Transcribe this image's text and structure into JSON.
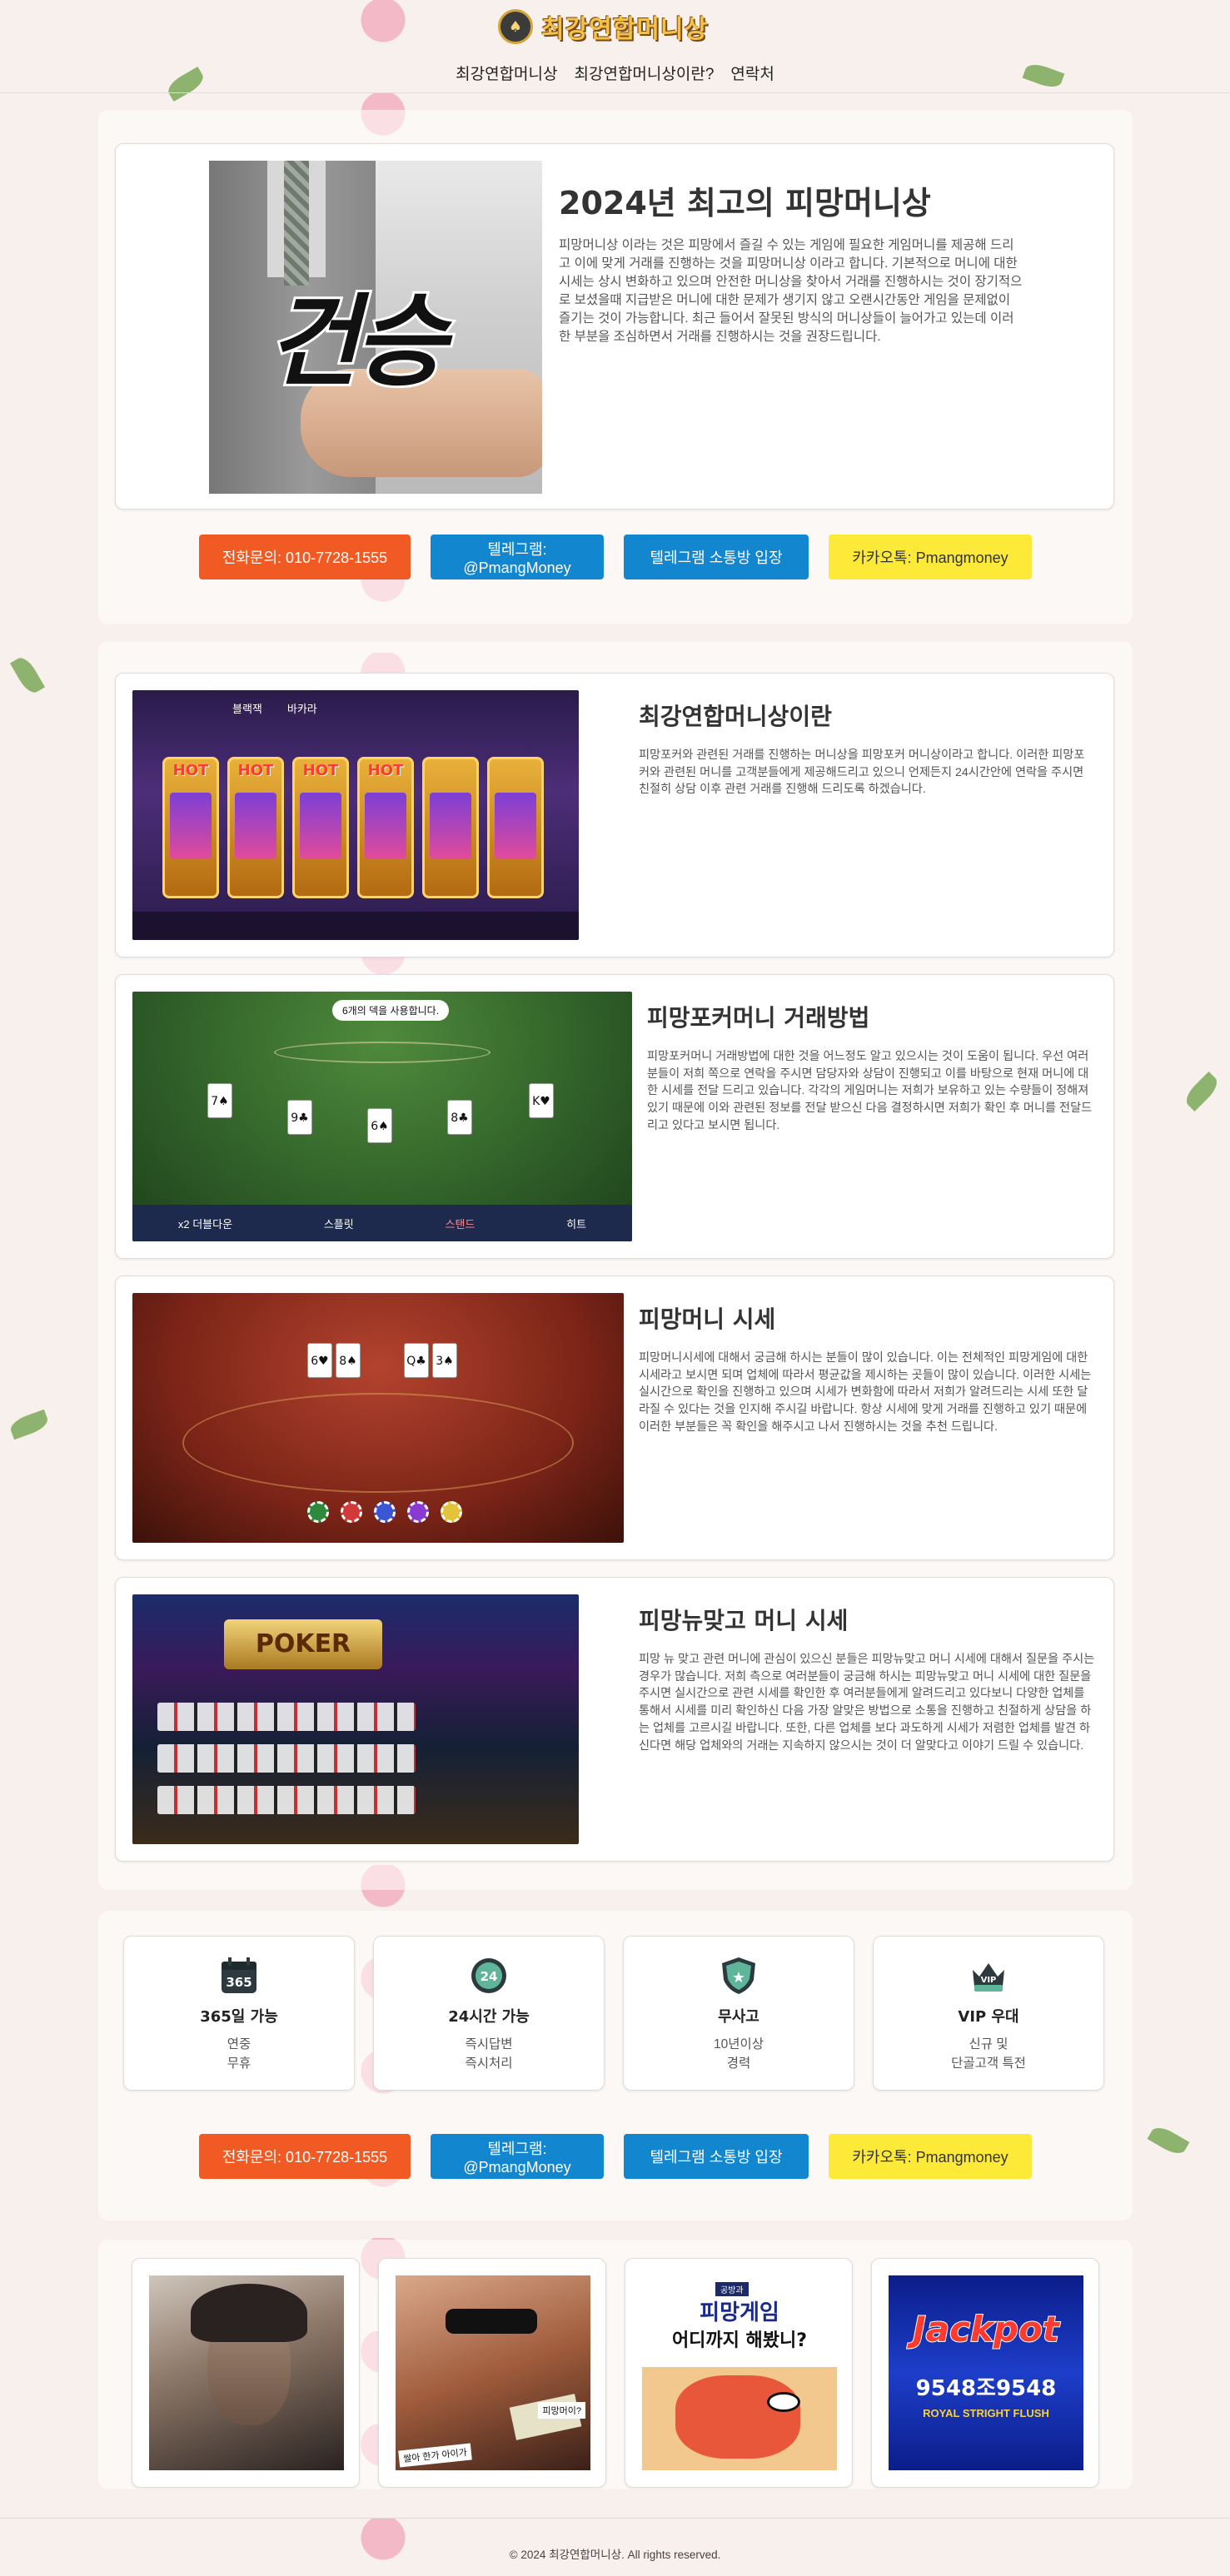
{
  "header": {
    "logo_text": "최강연합머니상",
    "nav": [
      {
        "label": "최강연합머니상"
      },
      {
        "label": "최강연합머니상이란?"
      },
      {
        "label": "연락처"
      }
    ]
  },
  "hero": {
    "image_word": "건승",
    "title": "2024년 최고의 피망머니상",
    "body": "피망머니상 이라는 것은 피망에서 즐길 수 있는 게임에 필요한 게임머니를 제공해 드리고 이에 맞게 거래를 진행하는 것을 피망머니상 이라고 합니다. 기본적으로 머니에 대한 시세는 상시 변화하고 있으며 안전한 머니상을 찾아서 거래를 진행하시는 것이 장기적으로 보셨을때 지급받은 머니에 대한 문제가 생기지 않고 오랜시간동안 게임을 문제없이 즐기는 것이 가능합니다. 최근 들어서 잘못된 방식의 머니상들이 늘어가고 있는데 이러한 부분을 조심하면서 거래를 진행하시는 것을 권장드립니다."
  },
  "buttons": {
    "phone": "전화문의: 010-7728-1555",
    "telegram": "텔레그램: @PmangMoney",
    "telegram_room": "텔레그램 소통방 입장",
    "kakao": "카카오톡: Pmangmoney"
  },
  "services": [
    {
      "title": "최강연합머니상이란",
      "body": "피망포커와 관련된 거래를 진행하는 머니상을 피망포커 머니상이라고 합니다. 이러한 피망포커와 관련된 머니를 고객분들에게 제공해드리고 있으니 언제든지 24시간안에 연락을 주시면 친절히 상담 이후 관련 거래를 진행해 드리도록 하겠습니다."
    },
    {
      "title": "피망포커머니 거래방법",
      "body": "피망포커머니 거래방법에 대한 것을 어느정도 알고 있으시는 것이 도움이 됩니다. 우선 여러분들이 저희 쪽으로 연락을 주시면 담당자와 상담이 진행되고 이를 바탕으로 현재 머니에 대한 시세를 전달 드리고 있습니다. 각각의 게임머니는 저희가 보유하고 있는 수량들이 정해져 있기 때문에 이와 관련된 정보를 전달 받으신 다음 결정하시면 저희가 확인 후 머니를 전달드리고 있다고 보시면 됩니다."
    },
    {
      "title": "피망머니 시세",
      "body": "피망머니시세에 대해서 궁금해 하시는 분들이 많이 있습니다. 이는 전체적인 피망게임에 대한 시세라고 보시면 되며 업체에 따라서 평균값을 제시하는 곳들이 많이 있습니다. 이러한 시세는 실시간으로 확인을 진행하고 있으며 시세가 변화함에 따라서 저희가 알려드리는 시세 또한 달라질 수 있다는 것을 인지해 주시길 바랍니다. 항상 시세에 맞게 거래를 진행하고 있기 때문에 이러한 부분들은 꼭 확인을 해주시고 나서 진행하시는 것을 추천 드립니다."
    },
    {
      "title": "피망뉴맞고 머니 시세",
      "body": "피망 뉴 맞고 관련 머니에 관심이 있으신 분들은 피망뉴맞고 머니 시세에 대해서 질문을 주시는 경우가 많습니다. 저희 측으로 여러분들이 궁금해 하시는 피망뉴맞고 머니 시세에 대한 질문을 주시면 실시간으로 관련 시세를 확인한 후 여러분들에게 알려드리고 있다보니 다양한 업체를 통해서 시세를 미리 확인하신 다음 가장 알맞은 방법으로 소통을 진행하고 친절하게 상담을 하는 업체를 고르시길 바랍니다. 또한, 다른 업체를 보다 과도하게 시세가 저렴한 업체를 발견 하신다면 해당 업체와의 거래는 지속하지 않으시는 것이 더 알맞다고 이야기 드릴 수 있습니다."
    }
  ],
  "game_art": {
    "slots_tabs": [
      "블랙잭",
      "바카라"
    ],
    "slots_hot": "HOT",
    "blackjack_toast": "6개의 덱을 사용합니다.",
    "blackjack_actions": [
      "x2 더블다운",
      "스플릿",
      "스탠드",
      "히트"
    ],
    "poker_title": "POKER"
  },
  "features": [
    {
      "icon": "calendar-365-icon",
      "icon_text": "365",
      "title": "365일 가능",
      "lines": [
        "연중",
        "무휴"
      ]
    },
    {
      "icon": "clock-24h-icon",
      "icon_text": "24",
      "title": "24시간 가능",
      "lines": [
        "즉시답변",
        "즉시처리"
      ]
    },
    {
      "icon": "shield-star-icon",
      "icon_text": "★",
      "title": "무사고",
      "lines": [
        "10년이상",
        "경력"
      ]
    },
    {
      "icon": "vip-crown-icon",
      "icon_text": "VIP",
      "title": "VIP 우대",
      "lines": [
        "신규 및",
        "단골고객 특전"
      ]
    }
  ],
  "gallery": {
    "g2_caption_1": "피망머이?",
    "g2_caption_2": "쌀아 한가 아이가",
    "g3_badge": "공방과",
    "g3_title_1": "피망게임",
    "g3_title_2": "어디까지 해봤니?",
    "g4_title": "Jackpot",
    "g4_numbers": "9548조9548",
    "g4_sub": "ROYAL STRIGHT FLUSH"
  },
  "footer": {
    "copyright": "© 2024 최강연합머니상. All rights reserved."
  },
  "colors": {
    "phone_button": "#f25a24",
    "telegram_button": "#1287cf",
    "kakao_button": "#fde937",
    "logo_gold": "#f4c14b"
  }
}
